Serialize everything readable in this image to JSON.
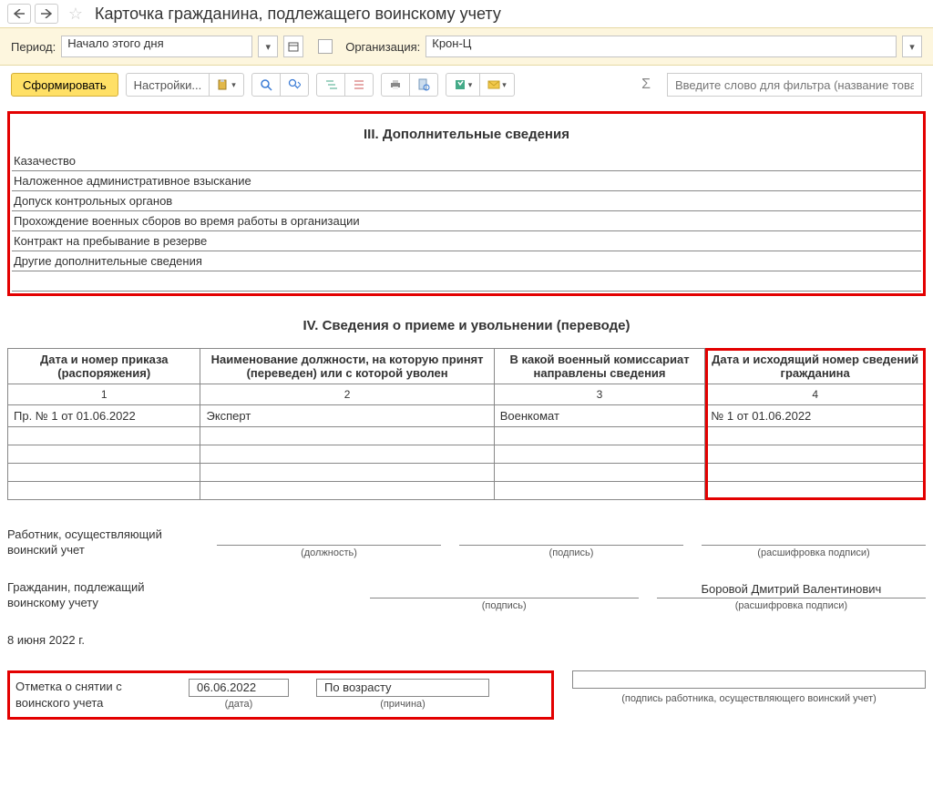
{
  "header": {
    "title": "Карточка гражданина, подлежащего воинскому учету"
  },
  "filters": {
    "period_label": "Период:",
    "period_value": "Начало этого дня",
    "org_label": "Организация:",
    "org_value": "Крон-Ц"
  },
  "toolbar": {
    "generate": "Сформировать",
    "settings": "Настройки...",
    "filter_placeholder": "Введите слово для фильтра (название товара, по..."
  },
  "section3": {
    "title": "III. Дополнительные сведения",
    "rows": [
      "Казачество",
      "Наложенное административное взыскание",
      "Допуск контрольных органов",
      "Прохождение военных сборов во время работы в организации",
      "Контракт на пребывание в резерве",
      "Другие дополнительные сведения"
    ]
  },
  "section4": {
    "title": "IV. Сведения о приеме и увольнении (переводе)",
    "headers": [
      "Дата и номер приказа (распоряжения)",
      "Наименование должности, на которую принят (переведен) или с которой уволен",
      "В какой военный комиссариат направлены сведения",
      "Дата и исходящий номер сведений гражданина"
    ],
    "nums": [
      "1",
      "2",
      "3",
      "4"
    ],
    "data_row": {
      "c1": "Пр. № 1 от 01.06.2022",
      "c2": "Эксперт",
      "c3": "Военкомат",
      "c4": "№ 1 от 01.06.2022"
    }
  },
  "signatures": {
    "worker_label": "Работник, осуществляющий воинский учет",
    "position_cap": "(должность)",
    "signature_cap": "(подпись)",
    "decipher_cap": "(расшифровка подписи)",
    "citizen_label": "Гражданин, подлежащий воинскому учету",
    "citizen_name": "Боровой Дмитрий Валентинович",
    "date_text": "8 июня 2022 г."
  },
  "removal": {
    "label": "Отметка о снятии с воинского учета",
    "date_value": "06.06.2022",
    "date_cap": "(дата)",
    "reason_value": "По возрасту",
    "reason_cap": "(причина)",
    "sign_cap": "(подпись работника, осуществляющего воинский учет)"
  }
}
